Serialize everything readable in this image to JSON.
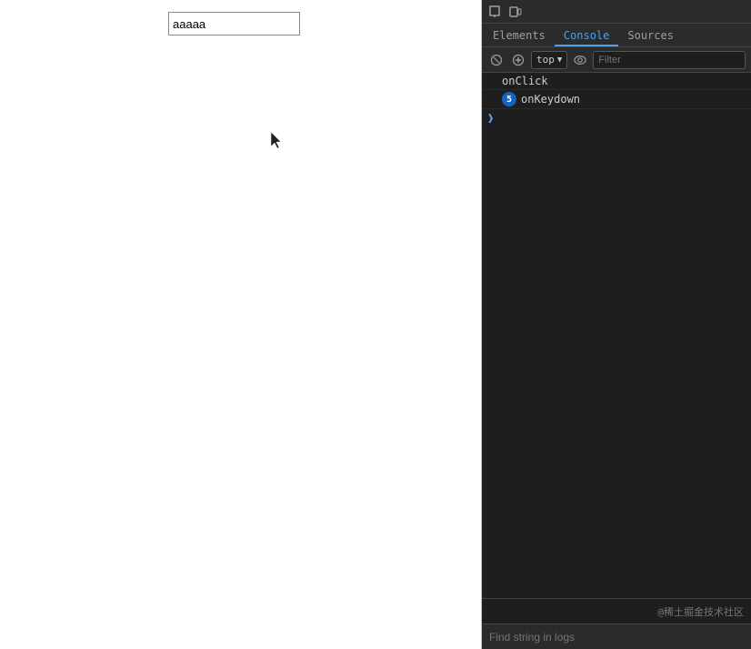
{
  "left_panel": {
    "input_value": "aaaaa"
  },
  "devtools": {
    "toolbar_icons": [
      {
        "name": "cursor-icon",
        "glyph": "⬚"
      },
      {
        "name": "device-icon",
        "glyph": "▭"
      }
    ],
    "tabs": [
      {
        "id": "elements",
        "label": "Elements",
        "active": false
      },
      {
        "id": "console",
        "label": "Console",
        "active": true
      },
      {
        "id": "sources",
        "label": "Sources",
        "active": false
      }
    ],
    "console_toolbar": {
      "top_label": "top",
      "filter_placeholder": "Filter"
    },
    "console_entries": [
      {
        "id": "onclick",
        "text": "onClick",
        "badge": null,
        "has_arrow": false
      },
      {
        "id": "onkeydown",
        "text": "onKeydown",
        "badge": "5",
        "has_arrow": false
      }
    ],
    "bottom_watermark": "@稀土掘金技术社区",
    "find_string_label": "Find string in logs"
  }
}
